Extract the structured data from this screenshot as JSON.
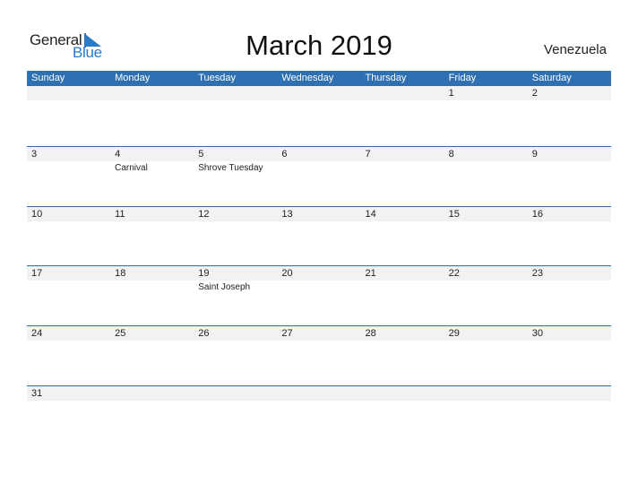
{
  "logo": {
    "word1": "General",
    "word2": "Blue"
  },
  "title": "March 2019",
  "country": "Venezuela",
  "colors": {
    "header": "#2e70b2",
    "accent": "#2a7ac8",
    "strip": "#f2f2f2"
  },
  "weekdays": [
    "Sunday",
    "Monday",
    "Tuesday",
    "Wednesday",
    "Thursday",
    "Friday",
    "Saturday"
  ],
  "weeks": [
    {
      "days": [
        "",
        "",
        "",
        "",
        "",
        "1",
        "2"
      ],
      "events": [
        "",
        "",
        "",
        "",
        "",
        "",
        ""
      ]
    },
    {
      "days": [
        "3",
        "4",
        "5",
        "6",
        "7",
        "8",
        "9"
      ],
      "events": [
        "",
        "Carnival",
        "Shrove Tuesday",
        "",
        "",
        "",
        ""
      ]
    },
    {
      "days": [
        "10",
        "11",
        "12",
        "13",
        "14",
        "15",
        "16"
      ],
      "events": [
        "",
        "",
        "",
        "",
        "",
        "",
        ""
      ]
    },
    {
      "days": [
        "17",
        "18",
        "19",
        "20",
        "21",
        "22",
        "23"
      ],
      "events": [
        "",
        "",
        "Saint Joseph",
        "",
        "",
        "",
        ""
      ]
    },
    {
      "days": [
        "24",
        "25",
        "26",
        "27",
        "28",
        "29",
        "30"
      ],
      "events": [
        "",
        "",
        "",
        "",
        "",
        "",
        ""
      ]
    },
    {
      "days": [
        "31",
        "",
        "",
        "",
        "",
        "",
        ""
      ],
      "events": [
        "",
        "",
        "",
        "",
        "",
        "",
        ""
      ]
    }
  ]
}
